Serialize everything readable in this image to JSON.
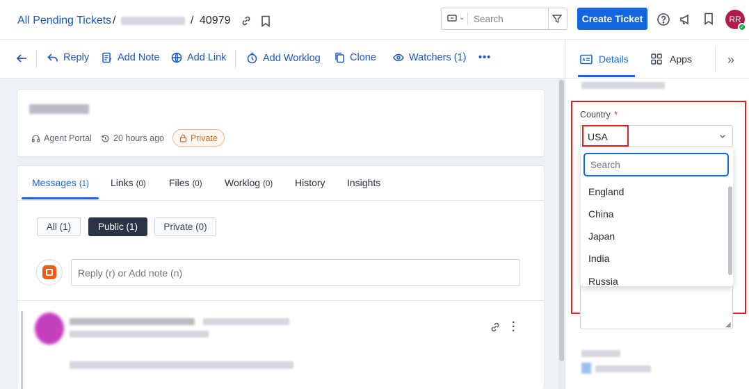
{
  "header": {
    "breadcrumb_root": "All Pending Tickets",
    "separator_1": "/",
    "separator_2": "/",
    "ticket_id": "40979",
    "search_placeholder": "Search",
    "create_ticket_label": "Create Ticket",
    "avatar_initials": "RR"
  },
  "toolbar": {
    "reply": "Reply",
    "add_note": "Add Note",
    "add_link": "Add Link",
    "add_worklog": "Add Worklog",
    "clone": "Clone",
    "watchers": "Watchers (1)",
    "more": "•••"
  },
  "ticket": {
    "source": "Agent Portal",
    "age": "20 hours ago",
    "visibility": "Private"
  },
  "tabs": [
    {
      "label": "Messages",
      "count": "(1)"
    },
    {
      "label": "Links",
      "count": "(0)"
    },
    {
      "label": "Files",
      "count": "(0)"
    },
    {
      "label": "Worklog",
      "count": "(0)"
    },
    {
      "label": "History",
      "count": ""
    },
    {
      "label": "Insights",
      "count": ""
    }
  ],
  "filters": {
    "all": "All (1)",
    "public": "Public (1)",
    "private": "Private (0)"
  },
  "reply_placeholder": "Reply (r) or Add note (n)",
  "right_panel": {
    "details_tab": "Details",
    "apps_tab": "Apps",
    "country_label": "Country",
    "required_marker": "*",
    "country_value": "USA",
    "dropdown_search_placeholder": "Search",
    "country_options": [
      "England",
      "China",
      "Japan",
      "India",
      "Russia"
    ]
  },
  "colors": {
    "accent": "#1565e0",
    "link": "#1a56c4",
    "highlight": "#e0201f",
    "private_badge": "#d7681f"
  }
}
